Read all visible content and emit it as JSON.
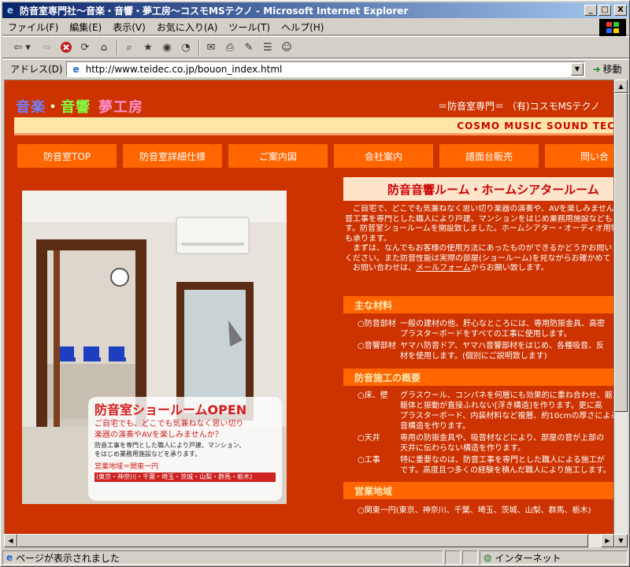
{
  "window": {
    "title": "防音室専門社～音楽・音響・夢工房～コスモMSテクノ - Microsoft Internet Explorer",
    "minimize": "_",
    "maximize": "□",
    "close": "X"
  },
  "menu": [
    "ファイル(F)",
    "編集(E)",
    "表示(V)",
    "お気に入り(A)",
    "ツール(T)",
    "ヘルプ(H)"
  ],
  "toolbar": {
    "back_icon": "back-arrow-icon",
    "forward_icon": "forward-arrow-icon",
    "stop_icon": "stop-icon",
    "refresh_icon": "refresh-icon",
    "home_icon": "home-icon",
    "search_icon": "search-icon",
    "favorites_icon": "favorites-icon",
    "history_icon": "history-icon",
    "mail_icon": "mail-icon",
    "print_icon": "print-icon",
    "edit_icon": "edit-icon",
    "discuss_icon": "discuss-icon"
  },
  "address": {
    "label": "アドレス(D)",
    "url": "http://www.teidec.co.jp/bouon_index.html",
    "go": "移動"
  },
  "page": {
    "logo": {
      "a": "音楽",
      "dot": "・",
      "b": "音響",
      "c": "夢工房"
    },
    "tagline": "＝防音室専門＝ （有)コスモMSテクノ",
    "cosmo": "COSMO MUSIC SOUND TEC",
    "nav": [
      "防音室TOP",
      "防音室詳細仕様",
      "ご案内図",
      "会社案内",
      "譜面台販売",
      "問い合"
    ],
    "photo": {
      "headline": "防音室ショールームOPEN",
      "line1": "ご自宅でも、どこでも気兼ねなく思い切り",
      "line2": "楽器の演奏やAVを楽しみませんか？",
      "line3": "防音工事を専門とした職人により戸建、マンション、",
      "line4": "をはじめ業務用施設などを承ります。",
      "area_title": "営業地域＝関東一円",
      "area_list": "(東京・神奈川・千葉・埼玉・茨城・山梨・群馬・栃木)"
    },
    "heading": "防音音響ルーム・ホームシアタールーム",
    "intro": [
      "　ご自宅で、どこでも気兼ねなく思い切り楽器の演奏や、AVを楽しみません",
      "音工事を専門とした職人により戸建、マンションをはじめ業務用施設なども",
      "す。防音室ショールームを開設致しました。ホームシアター・オーディオ用特",
      "も承ります。",
      "　まずは、なんでもお客様の使用方法にあったものができるかどうかお問い",
      "ください。また防音性能は実際の部屋(ショールーム)を見ながらお確かめて"
    ],
    "intro_last_pre": "　お問い合わせは、",
    "intro_link": "メールフォーム",
    "intro_last_post": "からお願い致します。",
    "sections": [
      {
        "title": "主な材料",
        "items": [
          {
            "k": "○防音部材",
            "v": [
              "一般の建材の他、肝心なところには、専用防振金具、高密",
              "プラスターボードをすべての工事に使用します。"
            ]
          },
          {
            "k": "○音響部材",
            "v": [
              "ヤマハ防音ドア、ヤマハ音響部材をはじめ、各種吸音、反",
              "材を使用します。(個別にご説明致します)"
            ]
          }
        ]
      },
      {
        "title": "防音施工の概要",
        "items": [
          {
            "k": "○床、壁",
            "v": [
              "グラスウール、コンパネを何層にも効果的に重ね合わせ、躯",
              "躯体と振動が直接ふれない[浮き構造]を作ります。更に高",
              "プラスターボード、内装材料など複層、約10cmの厚さによる",
              "音構造を作ります。"
            ]
          },
          {
            "k": "○天井",
            "v": [
              "専用の防振金具や、吸音材などにより、部屋の音が上部の",
              "天井に伝わらない構造を作ります。"
            ]
          },
          {
            "k": "○工事",
            "v": [
              "特に重要なのは、防音工事を専門とした職人による施工が",
              "です。高度且つ多くの経験を積んだ職人により施工します。"
            ]
          }
        ]
      },
      {
        "title": "営業地域",
        "items": [
          {
            "k": "○関東一円(東京、神奈川、千葉、埼玉、茨城、山梨、群馬、栃木)",
            "v": []
          }
        ]
      }
    ]
  },
  "status": {
    "text": "ページが表示されました",
    "zone": "インターネット"
  },
  "colors": {
    "page_bg": "#cc3300",
    "nav_bg": "#ff6600",
    "heading_bg": "#ffe4cc",
    "heading_text": "#cc0000",
    "beige_bar": "#ffe6a6"
  }
}
